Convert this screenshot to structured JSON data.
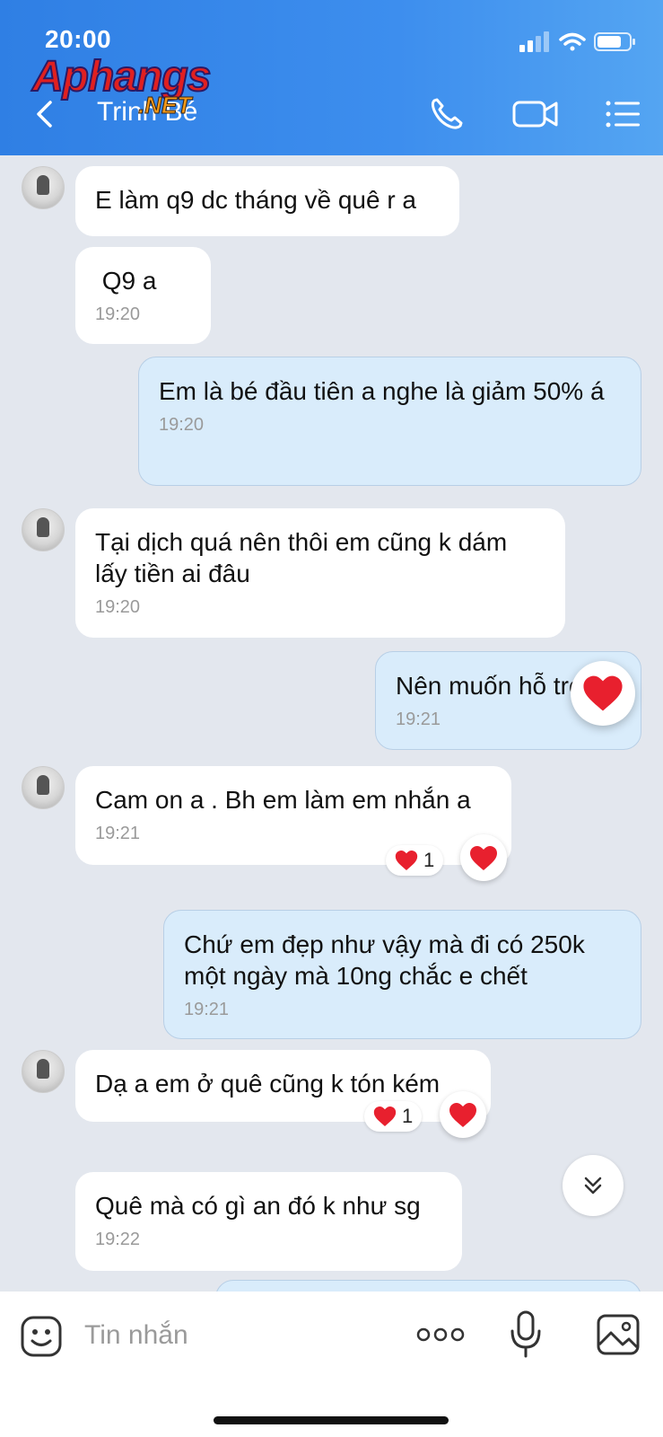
{
  "status_bar": {
    "time": "20:00"
  },
  "watermark": {
    "main": "Aphangs",
    "suffix": ".NET"
  },
  "header": {
    "contact_name": "Trinh Bé"
  },
  "messages": [
    {
      "side": "in",
      "text": "E làm q9 dc tháng về quê r a"
    },
    {
      "side": "in",
      "text": " Q9 a",
      "time": "19:20"
    },
    {
      "side": "out",
      "text": "Em là bé đầu tiên a nghe là giảm 50% á",
      "time": "19:20"
    },
    {
      "side": "in",
      "text": "Tại dịch quá nên thôi em cũng k dám lấy tiền ai đâu",
      "time": "19:20"
    },
    {
      "side": "out",
      "text": "Nên muốn hỗ trợ",
      "time": "19:21",
      "reaction": "heart"
    },
    {
      "side": "in",
      "text": "Cam on a . Bh em làm em nhắn a",
      "time": "19:21",
      "reaction_count": "1"
    },
    {
      "side": "out",
      "text": "Chứ em đẹp như vậy mà đi có 250k một ngày mà 10ng chắc e chết",
      "time": "19:21"
    },
    {
      "side": "in",
      "text": "Dạ a em ở quê cũng k tón kém",
      "reaction_count": "1"
    },
    {
      "side": "in",
      "text": "Quê mà có gì an đó k như sg",
      "time": "19:22"
    }
  ],
  "input": {
    "placeholder": "Tin nhắn"
  },
  "colors": {
    "header": "#3d8eee",
    "outgoing_bubble": "#d9ecfb",
    "incoming_bubble": "#ffffff",
    "background": "#e3e7ee",
    "heart": "#e8202e"
  },
  "icons": [
    "back-icon",
    "phone-icon",
    "video-call-icon",
    "menu-list-icon",
    "heart-icon",
    "scroll-down-icon",
    "sticker-icon",
    "more-icon",
    "microphone-icon",
    "image-icon",
    "signal-icon",
    "wifi-icon",
    "battery-icon"
  ]
}
